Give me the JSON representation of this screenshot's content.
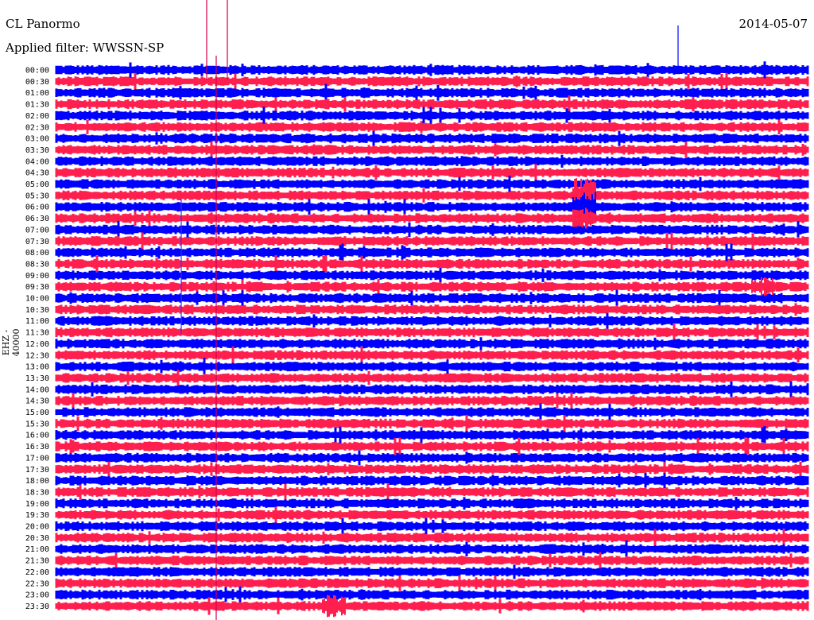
{
  "header": {
    "station": "CL Panormo",
    "date": "2014-05-07",
    "filter_label": "Applied filter: WWSSN-SP"
  },
  "channel_label": "EHZ - 40000",
  "chart_data": {
    "type": "line",
    "title": "CL Panormo",
    "subtitle": "Applied filter: WWSSN-SP",
    "ylabel": "EHZ - 40000",
    "date": "2014-05-07",
    "row_labels": [
      "00:00",
      "00:30",
      "01:00",
      "01:30",
      "02:00",
      "02:30",
      "03:00",
      "03:30",
      "04:00",
      "04:30",
      "05:00",
      "05:30",
      "06:00",
      "06:30",
      "07:00",
      "07:30",
      "08:00",
      "08:30",
      "09:00",
      "09:30",
      "10:00",
      "10:30",
      "11:00",
      "11:30",
      "12:00",
      "12:30",
      "13:00",
      "13:30",
      "14:00",
      "14:30",
      "15:00",
      "15:30",
      "16:00",
      "16:30",
      "17:00",
      "17:30",
      "18:00",
      "18:30",
      "19:00",
      "19:30",
      "20:00",
      "20:30",
      "21:00",
      "21:30",
      "22:00",
      "22:30",
      "23:00",
      "23:30"
    ],
    "row_minutes": 30,
    "trace_colors": [
      "#0000ff",
      "#ff1f4f"
    ],
    "grid": false,
    "legend": "none"
  }
}
